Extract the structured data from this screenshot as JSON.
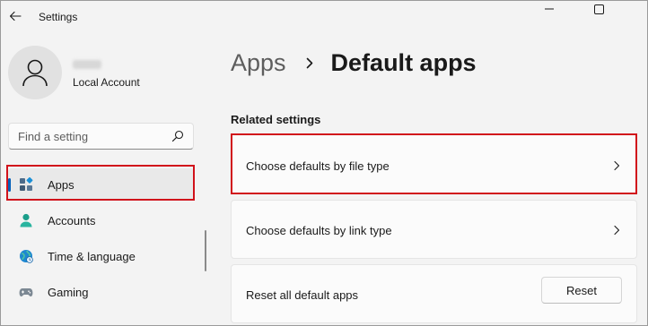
{
  "window": {
    "title": "Settings",
    "controls": [
      "minimize-icon",
      "maximize-icon"
    ]
  },
  "account": {
    "name": "jabin",
    "type": "Local Account"
  },
  "search": {
    "placeholder": "Find a setting",
    "value": ""
  },
  "sidebar": {
    "items": [
      {
        "label": "Apps",
        "icon": "apps-icon",
        "selected": true
      },
      {
        "label": "Accounts",
        "icon": "accounts-icon",
        "selected": false
      },
      {
        "label": "Time & language",
        "icon": "time-language-icon",
        "selected": false
      },
      {
        "label": "Gaming",
        "icon": "gaming-icon",
        "selected": false
      }
    ]
  },
  "breadcrumb": {
    "parent": "Apps",
    "current": "Default apps"
  },
  "related": {
    "title": "Related settings",
    "items": [
      {
        "label": "Choose defaults by file type",
        "icon": "chevron-right-icon"
      },
      {
        "label": "Choose defaults by link type",
        "icon": "chevron-right-icon"
      }
    ],
    "reset": {
      "label": "Reset all default apps",
      "button_label": "Reset"
    }
  },
  "colors": {
    "accent": "#005fb8",
    "highlight": "#d1121b",
    "background": "#f3f3f3",
    "card": "#fbfbfb"
  }
}
